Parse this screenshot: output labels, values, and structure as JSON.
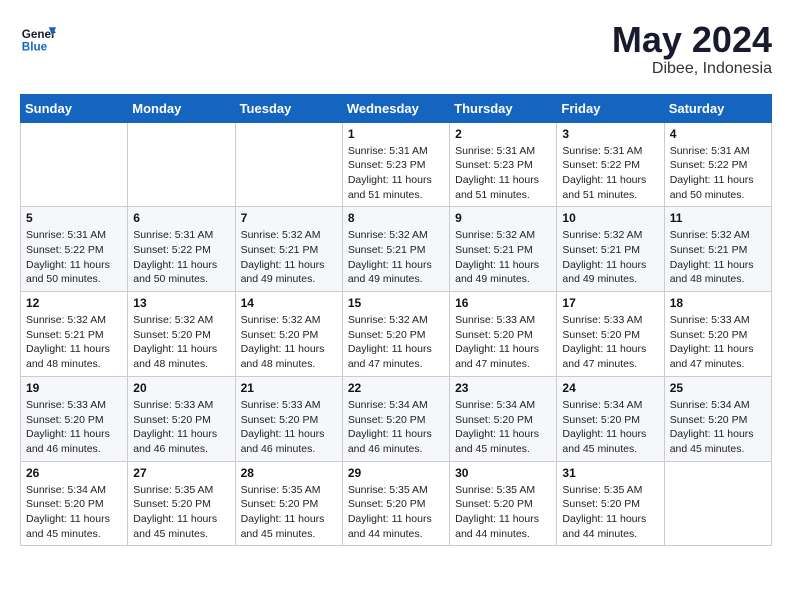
{
  "header": {
    "logo_line1": "General",
    "logo_line2": "Blue",
    "month_year": "May 2024",
    "location": "Dibee, Indonesia"
  },
  "weekdays": [
    "Sunday",
    "Monday",
    "Tuesday",
    "Wednesday",
    "Thursday",
    "Friday",
    "Saturday"
  ],
  "weeks": [
    [
      {
        "day": "",
        "info": ""
      },
      {
        "day": "",
        "info": ""
      },
      {
        "day": "",
        "info": ""
      },
      {
        "day": "1",
        "info": "Sunrise: 5:31 AM\nSunset: 5:23 PM\nDaylight: 11 hours and 51 minutes."
      },
      {
        "day": "2",
        "info": "Sunrise: 5:31 AM\nSunset: 5:23 PM\nDaylight: 11 hours and 51 minutes."
      },
      {
        "day": "3",
        "info": "Sunrise: 5:31 AM\nSunset: 5:22 PM\nDaylight: 11 hours and 51 minutes."
      },
      {
        "day": "4",
        "info": "Sunrise: 5:31 AM\nSunset: 5:22 PM\nDaylight: 11 hours and 50 minutes."
      }
    ],
    [
      {
        "day": "5",
        "info": "Sunrise: 5:31 AM\nSunset: 5:22 PM\nDaylight: 11 hours and 50 minutes."
      },
      {
        "day": "6",
        "info": "Sunrise: 5:31 AM\nSunset: 5:22 PM\nDaylight: 11 hours and 50 minutes."
      },
      {
        "day": "7",
        "info": "Sunrise: 5:32 AM\nSunset: 5:21 PM\nDaylight: 11 hours and 49 minutes."
      },
      {
        "day": "8",
        "info": "Sunrise: 5:32 AM\nSunset: 5:21 PM\nDaylight: 11 hours and 49 minutes."
      },
      {
        "day": "9",
        "info": "Sunrise: 5:32 AM\nSunset: 5:21 PM\nDaylight: 11 hours and 49 minutes."
      },
      {
        "day": "10",
        "info": "Sunrise: 5:32 AM\nSunset: 5:21 PM\nDaylight: 11 hours and 49 minutes."
      },
      {
        "day": "11",
        "info": "Sunrise: 5:32 AM\nSunset: 5:21 PM\nDaylight: 11 hours and 48 minutes."
      }
    ],
    [
      {
        "day": "12",
        "info": "Sunrise: 5:32 AM\nSunset: 5:21 PM\nDaylight: 11 hours and 48 minutes."
      },
      {
        "day": "13",
        "info": "Sunrise: 5:32 AM\nSunset: 5:20 PM\nDaylight: 11 hours and 48 minutes."
      },
      {
        "day": "14",
        "info": "Sunrise: 5:32 AM\nSunset: 5:20 PM\nDaylight: 11 hours and 48 minutes."
      },
      {
        "day": "15",
        "info": "Sunrise: 5:32 AM\nSunset: 5:20 PM\nDaylight: 11 hours and 47 minutes."
      },
      {
        "day": "16",
        "info": "Sunrise: 5:33 AM\nSunset: 5:20 PM\nDaylight: 11 hours and 47 minutes."
      },
      {
        "day": "17",
        "info": "Sunrise: 5:33 AM\nSunset: 5:20 PM\nDaylight: 11 hours and 47 minutes."
      },
      {
        "day": "18",
        "info": "Sunrise: 5:33 AM\nSunset: 5:20 PM\nDaylight: 11 hours and 47 minutes."
      }
    ],
    [
      {
        "day": "19",
        "info": "Sunrise: 5:33 AM\nSunset: 5:20 PM\nDaylight: 11 hours and 46 minutes."
      },
      {
        "day": "20",
        "info": "Sunrise: 5:33 AM\nSunset: 5:20 PM\nDaylight: 11 hours and 46 minutes."
      },
      {
        "day": "21",
        "info": "Sunrise: 5:33 AM\nSunset: 5:20 PM\nDaylight: 11 hours and 46 minutes."
      },
      {
        "day": "22",
        "info": "Sunrise: 5:34 AM\nSunset: 5:20 PM\nDaylight: 11 hours and 46 minutes."
      },
      {
        "day": "23",
        "info": "Sunrise: 5:34 AM\nSunset: 5:20 PM\nDaylight: 11 hours and 45 minutes."
      },
      {
        "day": "24",
        "info": "Sunrise: 5:34 AM\nSunset: 5:20 PM\nDaylight: 11 hours and 45 minutes."
      },
      {
        "day": "25",
        "info": "Sunrise: 5:34 AM\nSunset: 5:20 PM\nDaylight: 11 hours and 45 minutes."
      }
    ],
    [
      {
        "day": "26",
        "info": "Sunrise: 5:34 AM\nSunset: 5:20 PM\nDaylight: 11 hours and 45 minutes."
      },
      {
        "day": "27",
        "info": "Sunrise: 5:35 AM\nSunset: 5:20 PM\nDaylight: 11 hours and 45 minutes."
      },
      {
        "day": "28",
        "info": "Sunrise: 5:35 AM\nSunset: 5:20 PM\nDaylight: 11 hours and 45 minutes."
      },
      {
        "day": "29",
        "info": "Sunrise: 5:35 AM\nSunset: 5:20 PM\nDaylight: 11 hours and 44 minutes."
      },
      {
        "day": "30",
        "info": "Sunrise: 5:35 AM\nSunset: 5:20 PM\nDaylight: 11 hours and 44 minutes."
      },
      {
        "day": "31",
        "info": "Sunrise: 5:35 AM\nSunset: 5:20 PM\nDaylight: 11 hours and 44 minutes."
      },
      {
        "day": "",
        "info": ""
      }
    ]
  ]
}
